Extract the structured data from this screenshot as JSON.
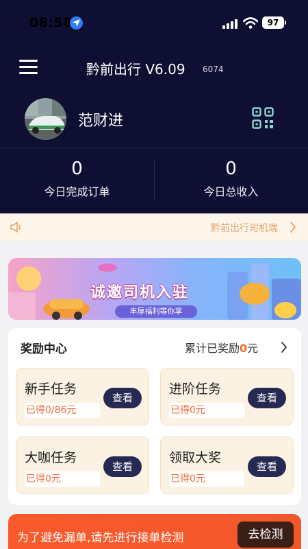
{
  "status_bar": {
    "time": "08:58",
    "battery": "97"
  },
  "header": {
    "title": "黔前出行 V6.09",
    "build": "6074"
  },
  "profile": {
    "name": "范财进"
  },
  "stats": [
    {
      "value": "0",
      "label": "今日完成订单"
    },
    {
      "value": "0",
      "label": "今日总收入"
    }
  ],
  "notice": {
    "text": "黔前出行司机端"
  },
  "banner": {
    "title": "诚邀司机入驻",
    "subtitle": "丰厚福利等你享"
  },
  "reward": {
    "title": "奖励中心",
    "total_prefix": "累计已奖励",
    "total_amount": "0",
    "total_suffix": "元",
    "tasks": [
      {
        "name": "新手任务",
        "earned": "已得0/86元",
        "button": "查看"
      },
      {
        "name": "进阶任务",
        "earned": "已得0元",
        "button": "查看"
      },
      {
        "name": "大咖任务",
        "earned": "已得0元",
        "button": "查看"
      },
      {
        "name": "领取大奖",
        "earned": "已得0元",
        "button": "查看"
      }
    ]
  },
  "alert": {
    "text": "为了避免漏单,请先进行接单检测",
    "button": "去检测"
  },
  "colors": {
    "header_bg": "#0e0f33",
    "accent_orange": "#f26a2b",
    "button_dark": "#262a52",
    "alert_bg": "#f95a2c"
  }
}
